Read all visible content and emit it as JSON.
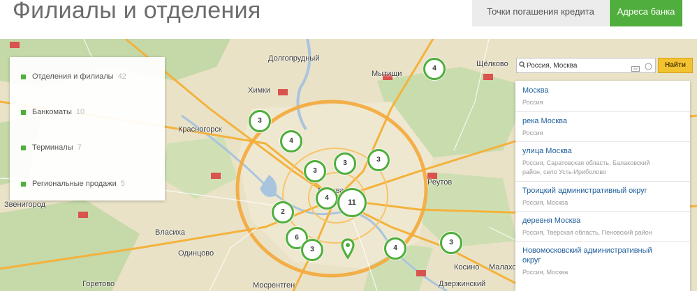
{
  "header": {
    "title": "Филиалы и отделения",
    "tabs": [
      {
        "label": "Точки погашения кредита"
      },
      {
        "label": "Адреса банка"
      }
    ]
  },
  "legend": {
    "items": [
      {
        "label": "Отделения и филиалы",
        "count": "42"
      },
      {
        "label": "Банкоматы",
        "count": "10"
      },
      {
        "label": "Терминалы",
        "count": "7"
      },
      {
        "label": "Региональные продажи",
        "count": "5"
      }
    ]
  },
  "map_labels": {
    "dolgoprudny": "Долгопрудный",
    "mytishchi": "Мытищи",
    "shchelkovo": "Щёлково",
    "khimki": "Химки",
    "krasnogorsk": "Красногорск",
    "zvenigorod": "Звенигород",
    "vlasikha": "Власиха",
    "odintsovo": "Одинцово",
    "reutov": "Реутов",
    "moscow": "Москва",
    "kosino": "Косино",
    "goretovo": "Горетово",
    "mosrentgen": "Мосрентген",
    "dzerzhinsky": "Дзержинский",
    "malakhovka": "Малаховка"
  },
  "markers": [
    {
      "count": "4"
    },
    {
      "count": "3"
    },
    {
      "count": "4"
    },
    {
      "count": "3"
    },
    {
      "count": "3"
    },
    {
      "count": "3"
    },
    {
      "count": "4"
    },
    {
      "count": "11"
    },
    {
      "count": "2"
    },
    {
      "count": "6"
    },
    {
      "count": "3"
    },
    {
      "count": "4"
    },
    {
      "count": "3"
    }
  ],
  "search": {
    "value": "Россия, Москва",
    "button_label": "Найти"
  },
  "results": [
    {
      "name": "Москва",
      "desc": "Россия"
    },
    {
      "name": "река Москва",
      "desc": "Россия"
    },
    {
      "name": "улица Москва",
      "desc": "Россия, Саратовская область, Балаковский",
      "desc2": "район, село Усть-Ириболово"
    },
    {
      "name": "Троицкий административный округ",
      "desc": "Россия, Москва"
    },
    {
      "name": "деревня Москва",
      "desc": "Россия, Тверская область, Пеновский район"
    },
    {
      "name": "Новомосковский административный",
      "name2": "округ",
      "desc": "Россия, Москва"
    }
  ],
  "colors": {
    "accent": "#4fae3c",
    "search_button": "#f2c230",
    "link": "#1f5e9c"
  }
}
